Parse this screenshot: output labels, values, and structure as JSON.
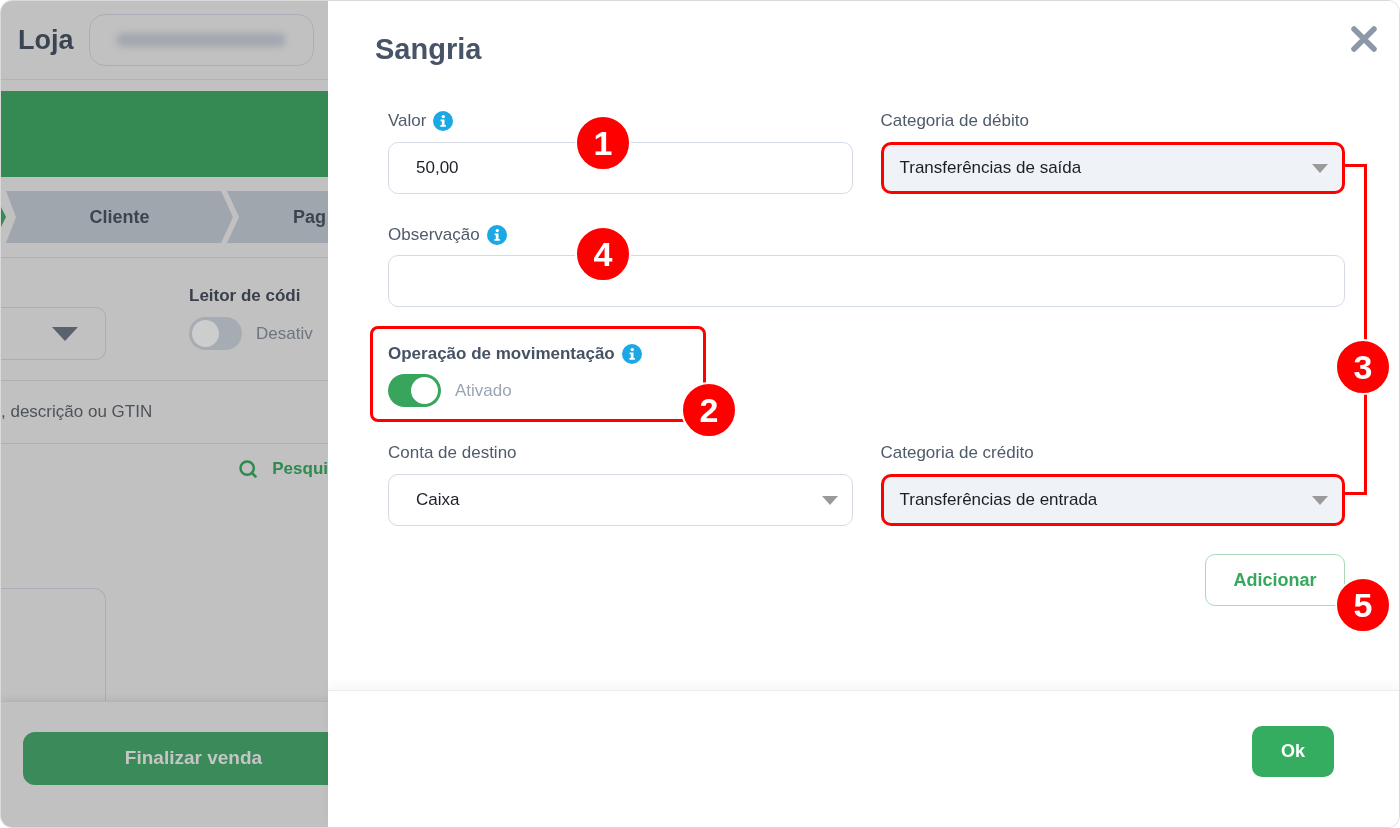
{
  "background": {
    "store_name": "Loja",
    "steps": [
      {
        "label": "Cliente"
      },
      {
        "label": "Pag"
      }
    ],
    "barcode_reader": {
      "label": "Leitor de códi",
      "on": false,
      "status": "Desativ"
    },
    "search_field": {
      "placeholder": ", descrição ou GTIN"
    },
    "search_link": "Pesqui",
    "finish_button": "Finalizar venda"
  },
  "dialog": {
    "title": "Sangria",
    "valor": {
      "label": "Valor",
      "info": true,
      "value": "50,00"
    },
    "categoria_debito": {
      "label": "Categoria de débito",
      "value": "Transferências de saída",
      "highlighted": true,
      "disabled": true
    },
    "observacao": {
      "label": "Observação",
      "info": true
    },
    "operacao": {
      "label": "Operação de movimentação",
      "info": true,
      "on": true,
      "status": "Ativado",
      "highlighted": true
    },
    "conta_destino": {
      "label": "Conta de destino",
      "value": "Caixa",
      "highlighted": false,
      "disabled": false
    },
    "categoria_credito": {
      "label": "Categoria de crédito",
      "value": "Transferências de entrada",
      "highlighted": true,
      "disabled": true
    },
    "add_button": "Adicionar",
    "ok_button": "Ok"
  },
  "callouts": [
    {
      "number": "1"
    },
    {
      "number": "2"
    },
    {
      "number": "3"
    },
    {
      "number": "4"
    },
    {
      "number": "5"
    }
  ]
}
